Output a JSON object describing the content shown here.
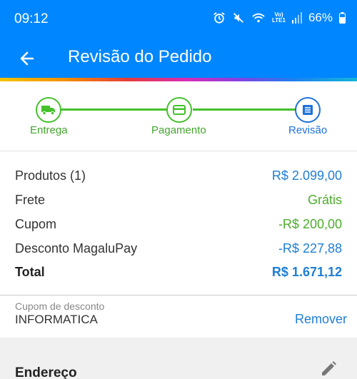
{
  "status_bar": {
    "time": "09:12",
    "lte_top": "Vo)",
    "lte_bottom": "LTE1",
    "battery": "66%",
    "icons": [
      "alarm-icon",
      "mute-icon",
      "wifi-icon",
      "signal-icon",
      "battery-icon"
    ]
  },
  "app_bar": {
    "title": "Revisão do Pedido",
    "back_icon": "arrow-left-icon"
  },
  "stepper": {
    "steps": [
      {
        "label": "Entrega",
        "icon": "truck-icon",
        "state": "complete"
      },
      {
        "label": "Pagamento",
        "icon": "card-icon",
        "state": "complete"
      },
      {
        "label": "Revisão",
        "icon": "document-icon",
        "state": "active"
      }
    ]
  },
  "summary": {
    "rows": [
      {
        "label": "Produtos (1)",
        "value": "R$ 2.099,00"
      },
      {
        "label": "Frete",
        "value": "Grátis"
      },
      {
        "label": "Cupom",
        "value": "-R$ 200,00"
      },
      {
        "label": "Desconto MagaluPay",
        "value": "-R$ 227,88"
      },
      {
        "label": "Total",
        "value": "R$ 1.671,12"
      }
    ]
  },
  "coupon": {
    "label": "Cupom de desconto",
    "code": "INFORMATICA",
    "remove": "Remover"
  },
  "address": {
    "title": "Endereço"
  },
  "colors": {
    "primary": "#0086ff",
    "green": "#44c12c",
    "link": "#1f7ed4"
  }
}
